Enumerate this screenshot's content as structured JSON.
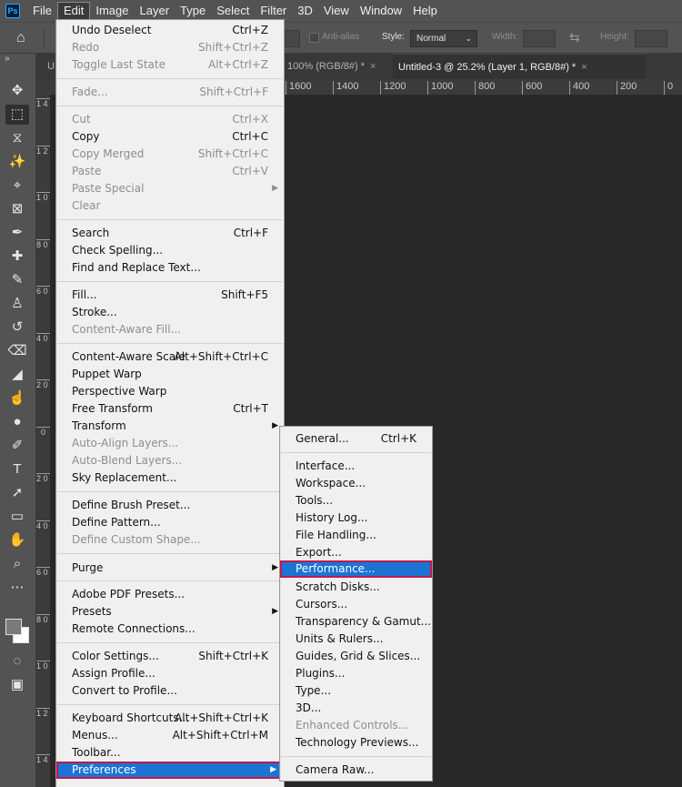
{
  "menubar": {
    "logo": "Ps",
    "items": [
      "File",
      "Edit",
      "Image",
      "Layer",
      "Type",
      "Select",
      "Filter",
      "3D",
      "View",
      "Window",
      "Help"
    ]
  },
  "options": {
    "antialias": "Anti-alias",
    "style_label": "Style:",
    "style_value": "Normal",
    "width_label": "Width:",
    "height_label": "Height:"
  },
  "tabs": [
    {
      "label": "U",
      "close": ""
    },
    {
      "label": "100% (RGB/8#) *",
      "close": "×"
    },
    {
      "label": "Untitled-3 @ 25.2% (Layer 1, RGB/8#) *",
      "close": "×"
    }
  ],
  "ruler": {
    "h_ticks": [
      "1600",
      "1400",
      "1200",
      "1000",
      "800",
      "600",
      "400",
      "200",
      "0"
    ],
    "v_ticks": [
      "1 4 0",
      "1 2 0",
      "1 0 0",
      "8 0 0",
      "6 0 0",
      "4 0 0",
      "2 0 0",
      "0",
      "2 0 0",
      "4 0 0",
      "6 0 0",
      "8 0 0",
      "1 0 0",
      "1 2 0",
      "1 4 0"
    ]
  },
  "edit_menu": {
    "items": [
      {
        "label": "Undo Deselect",
        "shortcut": "Ctrl+Z",
        "disabled": false
      },
      {
        "label": "Redo",
        "shortcut": "Shift+Ctrl+Z",
        "disabled": true
      },
      {
        "label": "Toggle Last State",
        "shortcut": "Alt+Ctrl+Z",
        "disabled": true
      },
      {
        "label": "Fade...",
        "shortcut": "Shift+Ctrl+F",
        "disabled": true
      },
      {
        "label": "Cut",
        "shortcut": "Ctrl+X",
        "disabled": true
      },
      {
        "label": "Copy",
        "shortcut": "Ctrl+C",
        "disabled": false
      },
      {
        "label": "Copy Merged",
        "shortcut": "Shift+Ctrl+C",
        "disabled": true
      },
      {
        "label": "Paste",
        "shortcut": "Ctrl+V",
        "disabled": true
      },
      {
        "label": "Paste Special",
        "shortcut": "",
        "disabled": true,
        "submenu": true
      },
      {
        "label": "Clear",
        "shortcut": "",
        "disabled": true
      },
      {
        "label": "Search",
        "shortcut": "Ctrl+F",
        "disabled": false
      },
      {
        "label": "Check Spelling...",
        "shortcut": "",
        "disabled": false
      },
      {
        "label": "Find and Replace Text...",
        "shortcut": "",
        "disabled": false
      },
      {
        "label": "Fill...",
        "shortcut": "Shift+F5",
        "disabled": false
      },
      {
        "label": "Stroke...",
        "shortcut": "",
        "disabled": false
      },
      {
        "label": "Content-Aware Fill...",
        "shortcut": "",
        "disabled": true
      },
      {
        "label": "Content-Aware Scale",
        "shortcut": "Alt+Shift+Ctrl+C",
        "disabled": false
      },
      {
        "label": "Puppet Warp",
        "shortcut": "",
        "disabled": false
      },
      {
        "label": "Perspective Warp",
        "shortcut": "",
        "disabled": false
      },
      {
        "label": "Free Transform",
        "shortcut": "Ctrl+T",
        "disabled": false
      },
      {
        "label": "Transform",
        "shortcut": "",
        "disabled": false,
        "submenu": true
      },
      {
        "label": "Auto-Align Layers...",
        "shortcut": "",
        "disabled": true
      },
      {
        "label": "Auto-Blend Layers...",
        "shortcut": "",
        "disabled": true
      },
      {
        "label": "Sky Replacement...",
        "shortcut": "",
        "disabled": false
      },
      {
        "label": "Define Brush Preset...",
        "shortcut": "",
        "disabled": false
      },
      {
        "label": "Define Pattern...",
        "shortcut": "",
        "disabled": false
      },
      {
        "label": "Define Custom Shape...",
        "shortcut": "",
        "disabled": true
      },
      {
        "label": "Purge",
        "shortcut": "",
        "disabled": false,
        "submenu": true
      },
      {
        "label": "Adobe PDF Presets...",
        "shortcut": "",
        "disabled": false
      },
      {
        "label": "Presets",
        "shortcut": "",
        "disabled": false,
        "submenu": true
      },
      {
        "label": "Remote Connections...",
        "shortcut": "",
        "disabled": false
      },
      {
        "label": "Color Settings...",
        "shortcut": "Shift+Ctrl+K",
        "disabled": false
      },
      {
        "label": "Assign Profile...",
        "shortcut": "",
        "disabled": false
      },
      {
        "label": "Convert to Profile...",
        "shortcut": "",
        "disabled": false
      },
      {
        "label": "Keyboard Shortcuts...",
        "shortcut": "Alt+Shift+Ctrl+K",
        "disabled": false
      },
      {
        "label": "Menus...",
        "shortcut": "Alt+Shift+Ctrl+M",
        "disabled": false
      },
      {
        "label": "Toolbar...",
        "shortcut": "",
        "disabled": false
      },
      {
        "label": "Preferences",
        "shortcut": "",
        "disabled": false,
        "submenu": true,
        "highlighted": true
      }
    ]
  },
  "pref_menu": {
    "items": [
      {
        "label": "General...",
        "shortcut": "Ctrl+K",
        "disabled": false
      },
      {
        "label": "Interface...",
        "shortcut": "",
        "disabled": false
      },
      {
        "label": "Workspace...",
        "shortcut": "",
        "disabled": false
      },
      {
        "label": "Tools...",
        "shortcut": "",
        "disabled": false
      },
      {
        "label": "History Log...",
        "shortcut": "",
        "disabled": false
      },
      {
        "label": "File Handling...",
        "shortcut": "",
        "disabled": false
      },
      {
        "label": "Export...",
        "shortcut": "",
        "disabled": false
      },
      {
        "label": "Performance...",
        "shortcut": "",
        "disabled": false,
        "highlighted": true
      },
      {
        "label": "Scratch Disks...",
        "shortcut": "",
        "disabled": false
      },
      {
        "label": "Cursors...",
        "shortcut": "",
        "disabled": false
      },
      {
        "label": "Transparency & Gamut...",
        "shortcut": "",
        "disabled": false
      },
      {
        "label": "Units & Rulers...",
        "shortcut": "",
        "disabled": false
      },
      {
        "label": "Guides, Grid & Slices...",
        "shortcut": "",
        "disabled": false
      },
      {
        "label": "Plugins...",
        "shortcut": "",
        "disabled": false
      },
      {
        "label": "Type...",
        "shortcut": "",
        "disabled": false
      },
      {
        "label": "3D...",
        "shortcut": "",
        "disabled": false
      },
      {
        "label": "Enhanced Controls...",
        "shortcut": "",
        "disabled": true
      },
      {
        "label": "Technology Previews...",
        "shortcut": "",
        "disabled": false
      },
      {
        "label": "Camera Raw...",
        "shortcut": "",
        "disabled": false
      }
    ]
  },
  "colors": {
    "highlight": "#1b74d3",
    "highlight_border": "#c2184b",
    "menu_bg": "#f0f0f0",
    "chrome": "#535353",
    "canvas": "#282828"
  },
  "toolbar_icons": [
    "move-icon",
    "marquee-icon",
    "lasso-icon",
    "magic-wand-icon",
    "crop-icon",
    "frame-icon",
    "eyedropper-icon",
    "healing-brush-icon",
    "brush-icon",
    "stamp-icon",
    "history-brush-icon",
    "eraser-icon",
    "paint-bucket-icon",
    "smudge-icon",
    "dodge-icon",
    "pen-icon",
    "type-icon",
    "path-selection-icon",
    "rectangle-icon",
    "hand-icon",
    "zoom-icon",
    "more-tools-icon"
  ]
}
